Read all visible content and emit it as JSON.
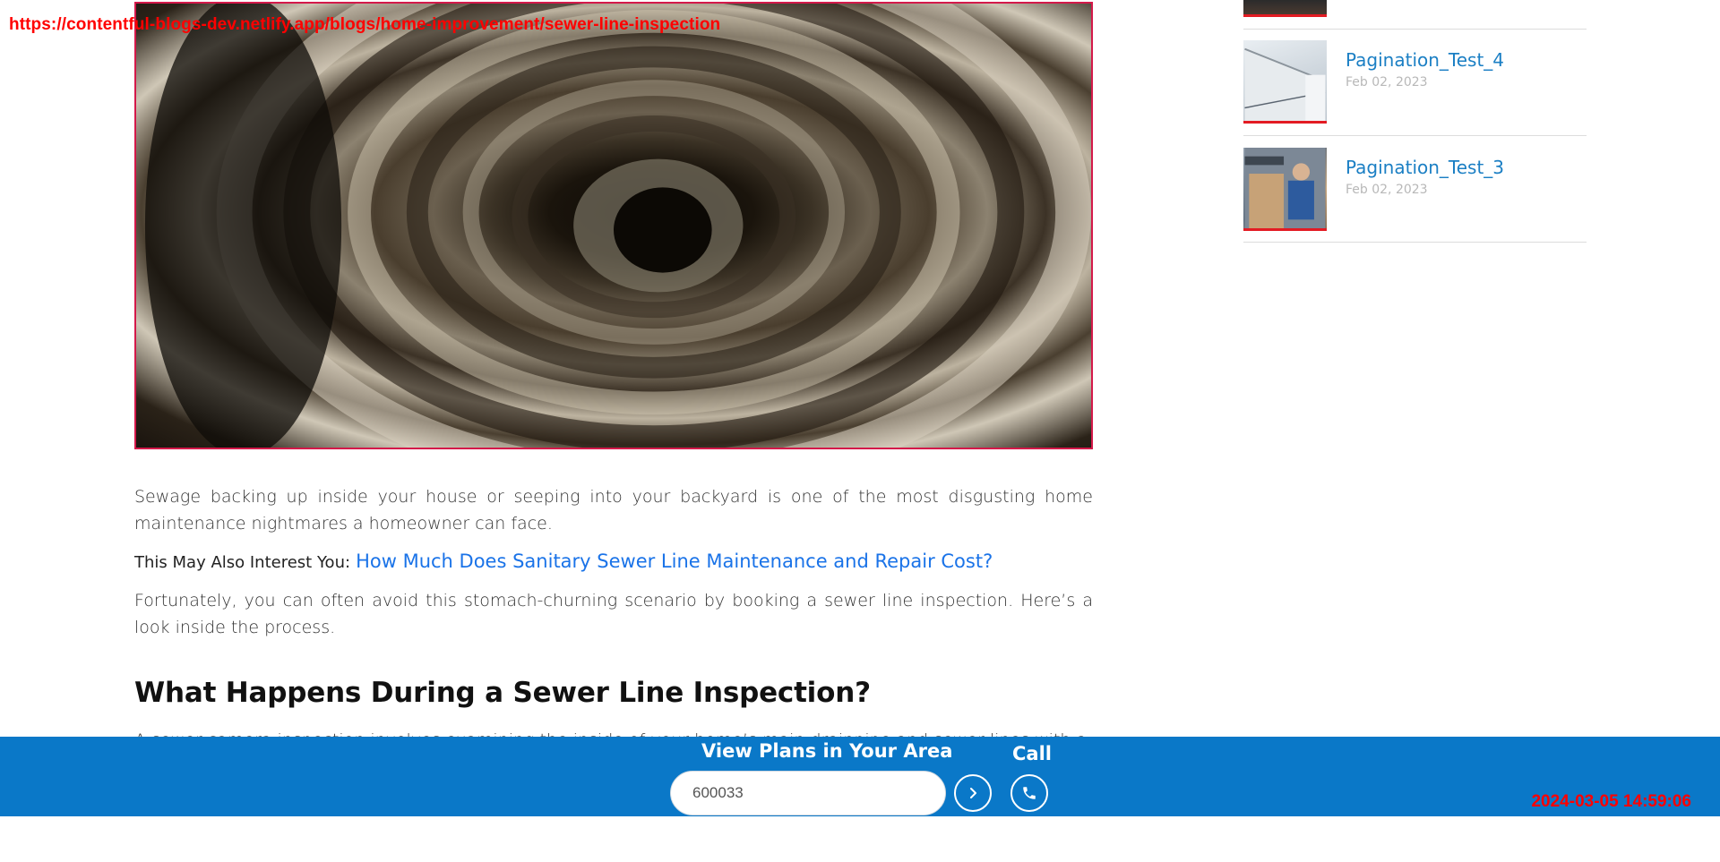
{
  "overlay": {
    "url": "https://contentful-blogs-dev.netlify.app/blogs/home-improvement/sewer-line-inspection",
    "timestamp": "2024-03-05 14:59:06"
  },
  "article": {
    "intro": "Sewage backing up inside your house or seeping into your backyard is one of the most disgusting home maintenance nightmares a homeowner can face.",
    "interest_label": "This May Also Interest You:",
    "interest_link": "How Much Does Sanitary Sewer Line Maintenance and Repair Cost?",
    "para2": "Fortunately, you can often avoid this stomach-churning scenario by booking a sewer line inspection. Here’s a look inside the process.",
    "heading": "What Happens During a Sewer Line Inspection?",
    "para3": "A sewer camera inspection involves examining the inside of your home’s main drainpipe and sewer lines with a"
  },
  "sidebar": {
    "items": [
      {
        "title": "Pagination_Test_4",
        "date": "Feb 02, 2023"
      },
      {
        "title": "Pagination_Test_3",
        "date": "Feb 02, 2023"
      }
    ]
  },
  "cta": {
    "title": "View Plans in Your Area",
    "zip_value": "600033",
    "call_label": "Call"
  },
  "colors": {
    "brand_blue": "#0a78c8",
    "link_blue": "#1a73e8",
    "sidebar_link": "#1b7fc4",
    "accent_red": "#e31b23"
  },
  "icons": {
    "go": "chevron-right-icon",
    "call": "phone-icon"
  }
}
